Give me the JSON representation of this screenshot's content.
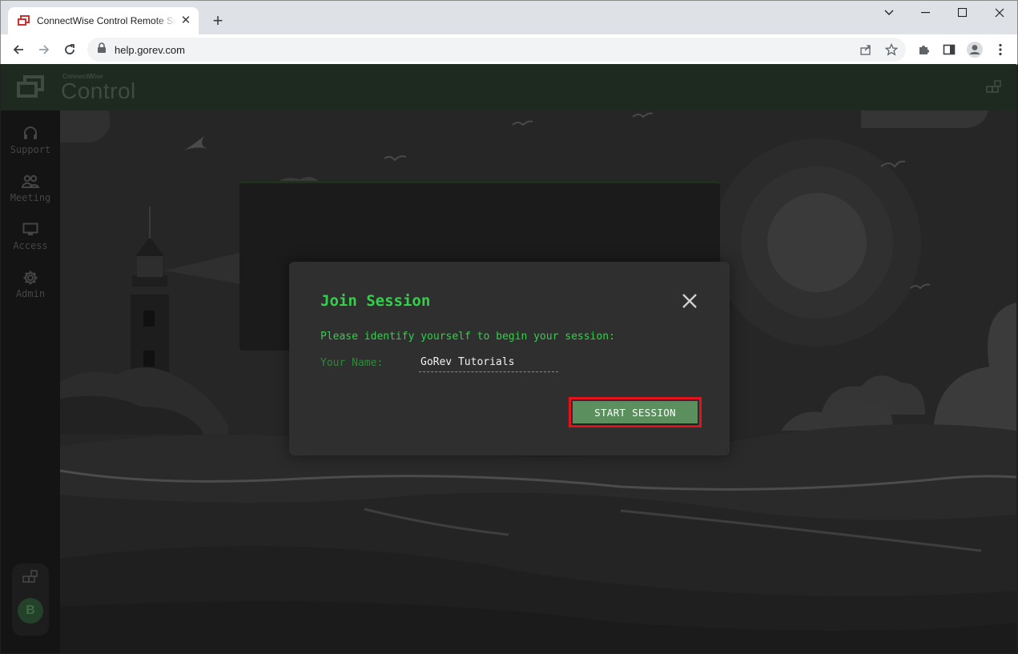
{
  "browser": {
    "tab_title": "ConnectWise Control Remote Support",
    "url": "help.gorev.com"
  },
  "app": {
    "logo_small": "ConnectWise",
    "logo_big": "Control",
    "sidebar": {
      "items": [
        {
          "label": "Support",
          "icon": "headset-icon"
        },
        {
          "label": "Meeting",
          "icon": "people-icon"
        },
        {
          "label": "Access",
          "icon": "monitor-icon"
        },
        {
          "label": "Admin",
          "icon": "gear-icon"
        }
      ],
      "avatar_initial": "B"
    }
  },
  "modal": {
    "title": "Join Session",
    "prompt": "Please identify yourself to begin your session:",
    "name_label": "Your Name:",
    "name_value": "GoRev Tutorials",
    "start_button": "START SESSION"
  },
  "colors": {
    "accent_green": "#33d04a",
    "button_green": "#5b8f5e",
    "highlight_red": "#e3131e"
  }
}
